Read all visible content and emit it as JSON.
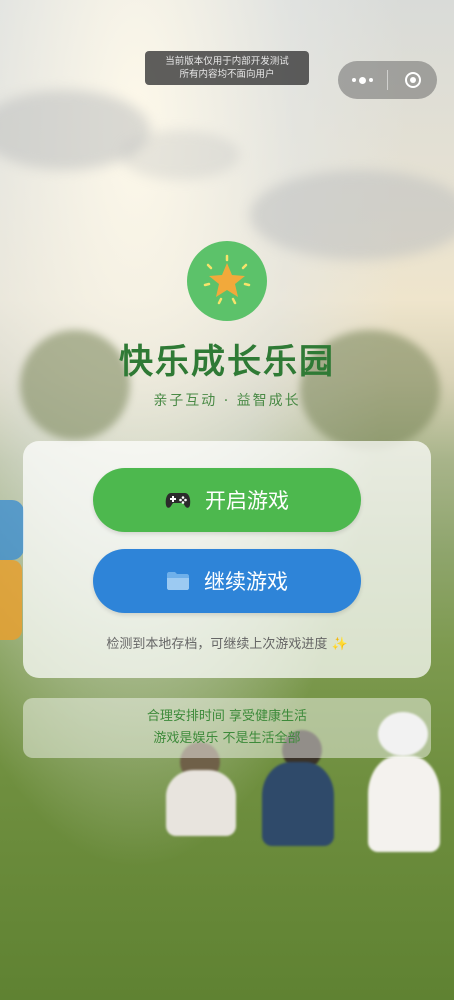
{
  "dev_notice": {
    "line1": "当前版本仅用于内部开发测试",
    "line2": "所有内容均不面向用户"
  },
  "capsule": {
    "menu_icon": "more-dots-icon",
    "close_icon": "target-close-icon"
  },
  "logo": {
    "icon": "star-icon",
    "bg_color": "#5cc26a",
    "star_color": "#f2a93b"
  },
  "title": "快乐成长乐园",
  "subtitle": "亲子互动 · 益智成长",
  "buttons": {
    "start": {
      "label": "开启游戏",
      "icon": "gamepad-icon",
      "color": "#4db84e"
    },
    "continue": {
      "label": "继续游戏",
      "icon": "folder-icon",
      "color": "#2e84d8"
    }
  },
  "save_hint": "检测到本地存档，可继续上次游戏进度 ✨",
  "tips": {
    "line1": "合理安排时间  享受健康生活",
    "line2": "游戏是娱乐  不是生活全部"
  }
}
